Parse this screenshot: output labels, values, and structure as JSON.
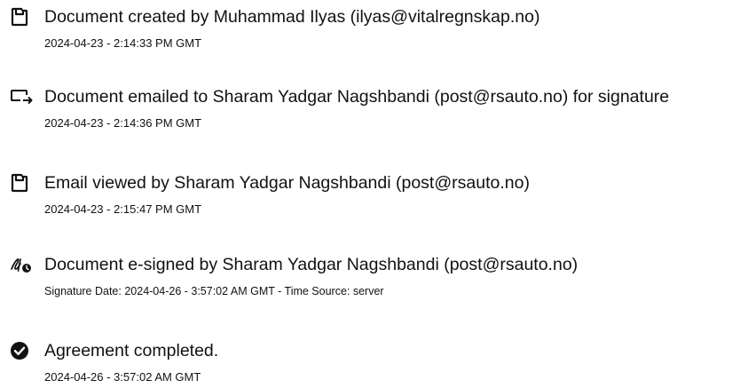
{
  "events": [
    {
      "icon": "document-created-icon",
      "title": "Document created by Muhammad Ilyas (ilyas@vitalregnskap.no)",
      "meta": "2024-04-23 - 2:14:33 PM GMT"
    },
    {
      "icon": "email-sent-icon",
      "title": "Document emailed to Sharam Yadgar Nagshbandi (post@rsauto.no) for signature",
      "meta": "2024-04-23 - 2:14:36 PM GMT"
    },
    {
      "icon": "document-viewed-icon",
      "title": "Email viewed by Sharam Yadgar Nagshbandi (post@rsauto.no)",
      "meta": "2024-04-23 - 2:15:47 PM GMT"
    },
    {
      "icon": "e-signature-icon",
      "title": "Document e-signed by Sharam Yadgar Nagshbandi (post@rsauto.no)",
      "meta": "Signature Date: 2024-04-26 - 3:57:02 AM GMT - Time Source: server"
    },
    {
      "icon": "check-circle-icon",
      "title": "Agreement completed.",
      "meta": "2024-04-26 - 3:57:02 AM GMT"
    }
  ]
}
